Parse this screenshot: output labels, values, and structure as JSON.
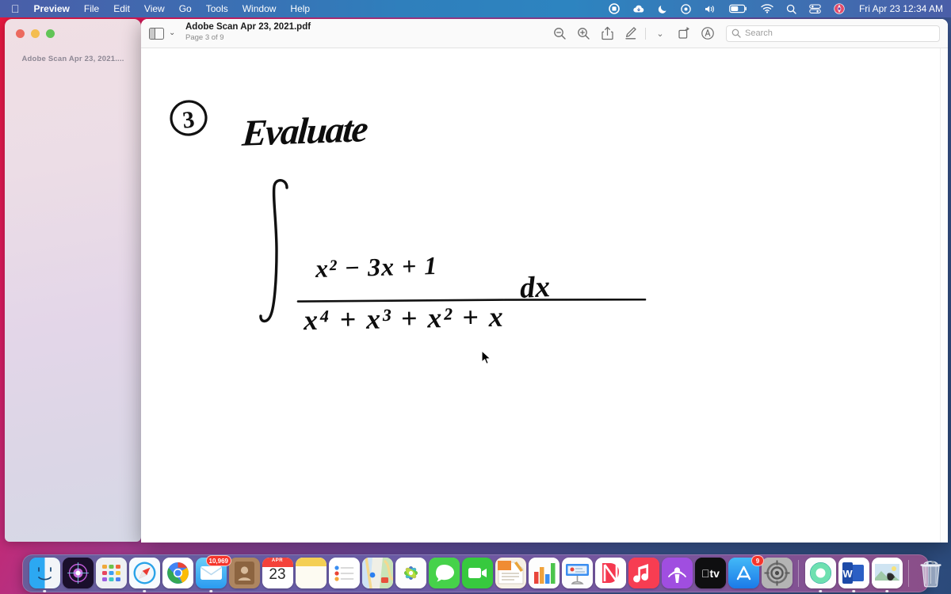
{
  "menubar": {
    "apple_glyph": "",
    "items": [
      {
        "label": "Preview",
        "bold": true
      },
      {
        "label": "File"
      },
      {
        "label": "Edit"
      },
      {
        "label": "View"
      },
      {
        "label": "Go"
      },
      {
        "label": "Tools"
      },
      {
        "label": "Window"
      },
      {
        "label": "Help"
      }
    ],
    "status_icons": [
      "stop-recording-icon",
      "cloud-icon",
      "do-not-disturb-moon-icon",
      "time-machine-icon",
      "volume-icon",
      "battery-icon",
      "wifi-icon",
      "spotlight-search-icon",
      "control-center-icon",
      "user-avatar-icon"
    ],
    "clock": "Fri Apr 23  12:34 AM"
  },
  "background_window": {
    "title": "Adobe Scan Apr 23, 2021...."
  },
  "preview_window": {
    "toolbar": {
      "sidebar_toggle": "sidebar-toggle",
      "sidebar_chevron": "⌄",
      "doc_title": "Adobe Scan Apr 23, 2021.pdf",
      "page_indicator": "Page 3 of 9",
      "buttons": [
        {
          "name": "zoom-out-button",
          "glyph": "zoom-out"
        },
        {
          "name": "zoom-in-button",
          "glyph": "zoom-in"
        },
        {
          "name": "share-button",
          "glyph": "share"
        },
        {
          "name": "markup-button",
          "glyph": "pen"
        },
        {
          "name": "markup-chevron-button",
          "glyph": "⌄"
        },
        {
          "name": "rotate-button",
          "glyph": "rotate"
        },
        {
          "name": "annotate-button",
          "glyph": "annotate"
        }
      ]
    },
    "search": {
      "placeholder": "Search",
      "value": ""
    },
    "document": {
      "problem_number": "3",
      "heading": "Evaluate",
      "integral": {
        "symbol": "∫",
        "numerator": "x² − 3x + 1",
        "denominator": "x⁴ + x³ + x² + x",
        "differential": "dx"
      }
    }
  },
  "dock": {
    "items": [
      {
        "name": "finder",
        "label": "Finder",
        "running": true
      },
      {
        "name": "siri",
        "label": "Siri",
        "running": false
      },
      {
        "name": "launchpad",
        "label": "Launchpad",
        "running": false
      },
      {
        "name": "safari",
        "label": "Safari",
        "running": true
      },
      {
        "name": "chrome",
        "label": "Google Chrome",
        "running": false
      },
      {
        "name": "mail",
        "label": "Mail",
        "badge": "10,969",
        "running": true
      },
      {
        "name": "contacts",
        "label": "Contacts",
        "running": false
      },
      {
        "name": "calendar",
        "label": "Calendar",
        "day": "23",
        "month": "APR",
        "running": false
      },
      {
        "name": "notes",
        "label": "Notes",
        "running": false
      },
      {
        "name": "reminders",
        "label": "Reminders",
        "running": false
      },
      {
        "name": "maps",
        "label": "Maps",
        "running": false
      },
      {
        "name": "photos",
        "label": "Photos",
        "running": false
      },
      {
        "name": "messages",
        "label": "Messages",
        "running": false
      },
      {
        "name": "facetime",
        "label": "FaceTime",
        "running": false
      },
      {
        "name": "pages",
        "label": "Pages",
        "running": false
      },
      {
        "name": "numbers",
        "label": "Numbers",
        "running": false
      },
      {
        "name": "keynote",
        "label": "Keynote",
        "running": false
      },
      {
        "name": "news",
        "label": "News",
        "running": false
      },
      {
        "name": "music",
        "label": "Music",
        "running": false
      },
      {
        "name": "podcasts",
        "label": "Podcasts",
        "running": false
      },
      {
        "name": "apple-tv",
        "label": "Apple TV",
        "running": false
      },
      {
        "name": "app-store",
        "label": "App Store",
        "badge": "9",
        "running": false
      },
      {
        "name": "system-preferences",
        "label": "System Preferences",
        "running": false
      },
      {
        "name": "webex",
        "label": "Webex",
        "running": true
      },
      {
        "name": "word",
        "label": "Microsoft Word",
        "running": true
      },
      {
        "name": "preview",
        "label": "Preview",
        "running": true
      },
      {
        "name": "trash",
        "label": "Trash",
        "running": false
      }
    ]
  },
  "colors": {
    "accent_red": "#e8173d",
    "menubar_blue": "#2d84c0",
    "badge_red": "#f5342b",
    "traffic_red": "#ec6a5f",
    "traffic_yellow": "#f4bd50",
    "traffic_green": "#61c456"
  }
}
